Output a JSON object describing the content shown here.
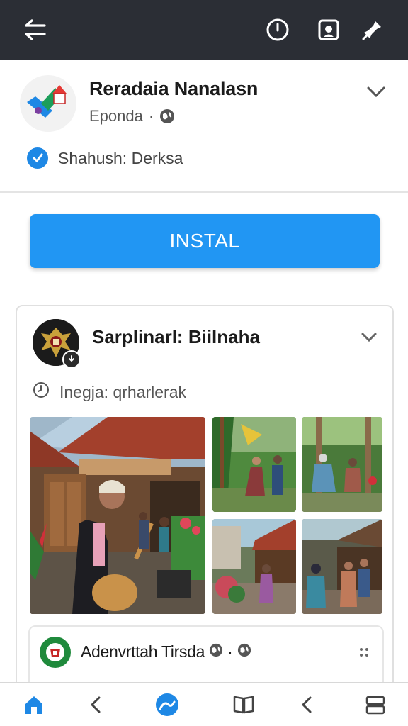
{
  "topbar": {
    "icons": [
      "back-arrow-icon",
      "clock-icon",
      "portrait-icon",
      "pin-icon"
    ]
  },
  "app": {
    "name": "Reradaia Nanalasn",
    "category": "Eponda",
    "separator": "·",
    "verified_text": "Shahush: Derksa",
    "install_label": "INSTAL"
  },
  "post": {
    "title": "Sarplinarl: Biilnaha",
    "meta": "Inegja: qrharlerak"
  },
  "comment": {
    "name": "Adenvrttah Tirsda",
    "separator": "·"
  },
  "bottom_nav": {
    "items": [
      "home-icon",
      "back-icon",
      "browser-icon",
      "book-icon",
      "back-icon",
      "tabs-icon"
    ]
  },
  "colors": {
    "topbar_bg": "#2b2e35",
    "install_bg": "#2196f3",
    "verified": "#1e88e5",
    "comment_avatar": "#1f8a3c",
    "home_active": "#1e88e5"
  }
}
